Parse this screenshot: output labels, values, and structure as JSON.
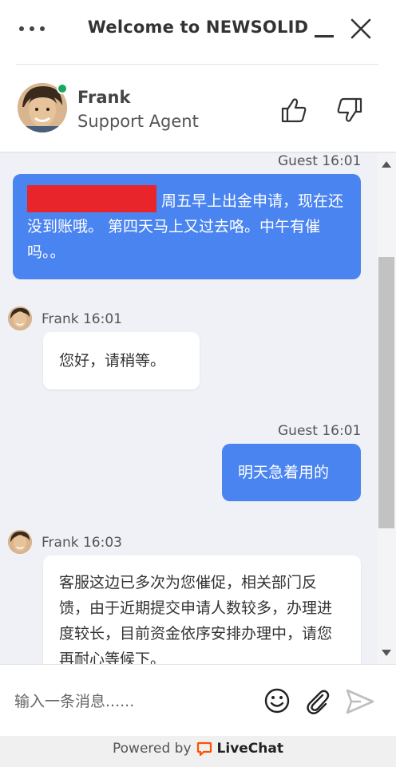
{
  "header": {
    "title": "Welcome to NEWSOLID",
    "agent": {
      "name": "Frank",
      "role": "Support Agent",
      "status_color": "#1aa65c"
    }
  },
  "messages": [
    {
      "author": "Guest",
      "time": "16:01",
      "meta": "Guest 16:01",
      "type": "guest",
      "redacted": true,
      "text": "周五早上出金申请，现在还没到账哦。 第四天马上又过去咯。中午有催吗。。"
    },
    {
      "author": "Frank",
      "time": "16:01",
      "meta": "Frank 16:01",
      "type": "agent",
      "text": "您好，请稍等。"
    },
    {
      "author": "Guest",
      "time": "16:01",
      "meta": "Guest 16:01",
      "type": "guest",
      "text": "明天急着用的"
    },
    {
      "author": "Frank",
      "time": "16:03",
      "meta": "Frank 16:03",
      "type": "agent",
      "text": "客服这边已多次为您催促，相关部门反馈，由于近期提交申请人数较多，办理进度较长，目前资金依序安排办理中，请您再耐心等候下。"
    }
  ],
  "composer": {
    "placeholder": "输入一条消息......"
  },
  "footer": {
    "powered_by": "Powered by",
    "brand": "LiveChat",
    "brand_color": "#ff5100"
  },
  "colors": {
    "guest_bubble": "#4a84f0",
    "chat_background": "#eff1f6",
    "redaction": "#e8252a"
  },
  "icons": [
    "more-dots-icon",
    "minimize-icon",
    "close-icon",
    "thumbs-up-icon",
    "thumbs-down-icon",
    "emoji-icon",
    "paperclip-icon",
    "send-icon",
    "livechat-logo-icon"
  ]
}
